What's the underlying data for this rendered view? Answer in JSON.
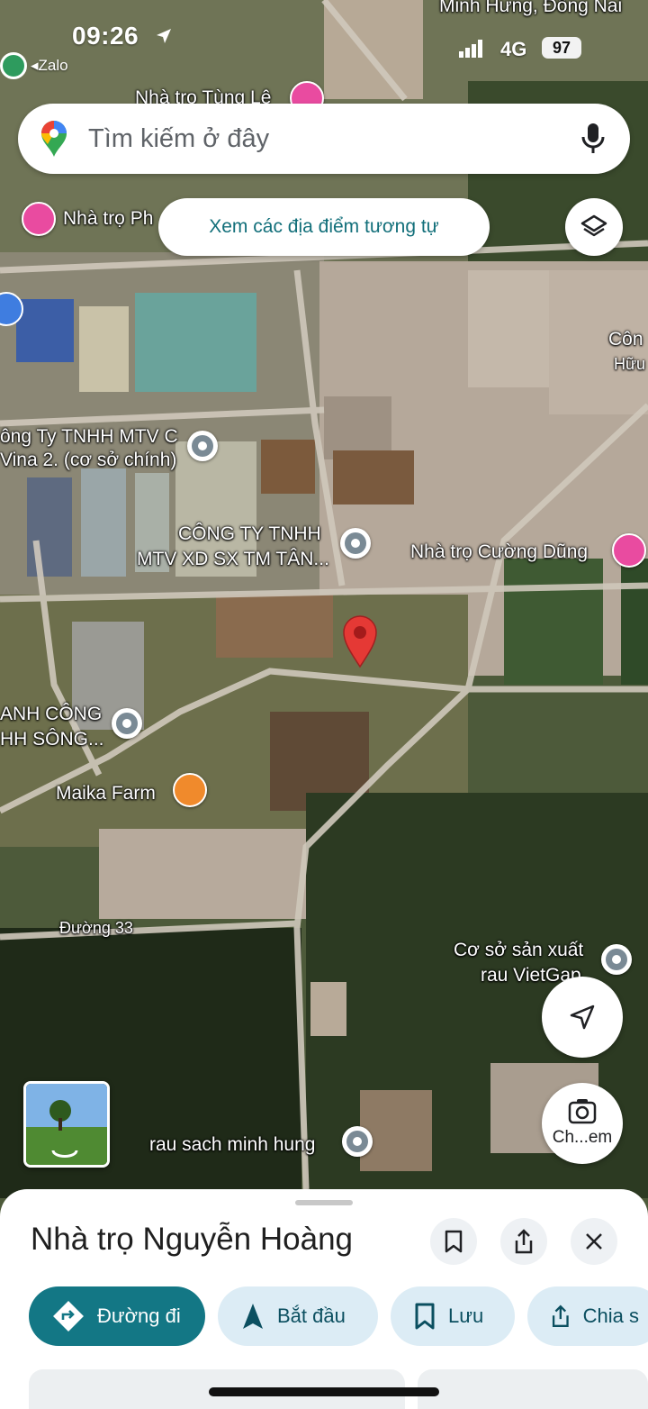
{
  "status_bar": {
    "time": "09:26",
    "back_app": "Zalo",
    "network": "4G",
    "battery": "97"
  },
  "search": {
    "placeholder": "Tìm kiếm ở đây",
    "icon": "google-maps-logo",
    "mic_icon": "mic-icon"
  },
  "similar_places_chip": "Xem các địa điểm tương tự",
  "layers_icon": "layers-icon",
  "map_labels": {
    "region_top": "Minh Hưng, Đồng Nai",
    "nha_tro_tung_le": "Nhà trọ Tùng Lê",
    "nha_tro_ph": "Nhà trọ Ph",
    "cong_right_1": "Côn",
    "cong_right_2": "Hữu",
    "company_c_1": "ông Ty TNHH MTV C",
    "company_c_2": "Vina 2. (cơ sở chính)",
    "company_tan_1": "CÔNG TY TNHH",
    "company_tan_2": "MTV XD SX TM TÂN...",
    "nha_tro_cuong_dung": "Nhà trọ Cường Dũng",
    "anh_cong_1": "ANH CÔNG",
    "anh_cong_2": "HH SÔNG...",
    "maika_farm": "Maika Farm",
    "duong_33": "Đường 33",
    "vietgap_1": "Cơ sở sản xuất",
    "vietgap_2": "rau VietGap",
    "rau_sach": "rau sach minh hung"
  },
  "lens_button": "Ch...em",
  "place": {
    "title": "Nhà trọ Nguyễn Hoàng",
    "buttons": {
      "directions": "Đường đi",
      "start": "Bắt đầu",
      "save": "Lưu",
      "share": "Chia s"
    }
  },
  "colors": {
    "accent": "#137785",
    "accent_light": "#dcecf5",
    "pin_red": "#e53935",
    "pin_pink": "#e94ba0",
    "pin_grey": "#7a8a95",
    "pin_orange": "#f08a2c"
  }
}
